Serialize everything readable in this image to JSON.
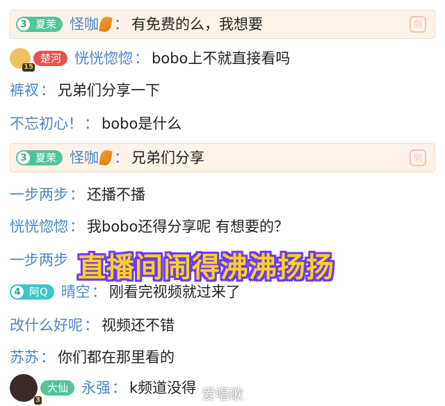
{
  "messages": [
    {
      "badge": {
        "level": "3",
        "label": "夏茉",
        "color": "green"
      },
      "user": "怪咖",
      "after_user_icon": "leaf-icon",
      "colon": "：",
      "text": "有免费的么，我想要",
      "highlight": true,
      "right_icon": {
        "name": "sword-icon",
        "glyph": "剑"
      }
    },
    {
      "avatar": {
        "name": "fox-avatar",
        "level": "15"
      },
      "badge": {
        "label": "楚河",
        "color": "red"
      },
      "user": "恍恍惚惚",
      "colon": "：",
      "text": "bobo上不就直接看吗"
    },
    {
      "user": "裤衩",
      "colon": "：",
      "text": "兄弟们分享一下"
    },
    {
      "user": "不忘初心！",
      "colon": "：",
      "text": "bobo是什么"
    },
    {
      "badge": {
        "level": "3",
        "label": "夏茉",
        "color": "green"
      },
      "user": "怪咖",
      "after_user_icon": "leaf-icon",
      "colon": "：",
      "text": "兄弟们分享",
      "highlight": true,
      "right_icon": {
        "name": "sword-icon",
        "glyph": "剑"
      }
    },
    {
      "user": "一步两步",
      "colon": "：",
      "text": "还播不播"
    },
    {
      "user": "恍恍惚惚",
      "colon": "：",
      "text": "我bobo还得分享呢 有想要的？"
    },
    {
      "user": "一步两步",
      "colon": "",
      "text": ""
    },
    {
      "badge": {
        "level": "4",
        "label": "阿Q",
        "color": "teal"
      },
      "user": "晴空",
      "colon": "：",
      "text": "刚看完视频就过来了"
    },
    {
      "user": "改什么好呢",
      "colon": "：",
      "text": "视频还不错"
    },
    {
      "user": "苏苏",
      "colon": "：",
      "text": "你们都在那里看的"
    },
    {
      "avatar": {
        "name": "girl-avatar",
        "level": "3"
      },
      "badge": {
        "label": "大仙",
        "color": "green"
      },
      "user": "永强",
      "colon": "：",
      "text": "k频道没得"
    }
  ],
  "overlay_caption": "直播间闹得沸沸扬扬",
  "watermark": "爱唱歌",
  "colors": {
    "username": "#4b86c7",
    "highlight_bg": "#fff3e9",
    "overlay_fill": "#ffd21a",
    "overlay_stroke": "#6a3bff"
  }
}
